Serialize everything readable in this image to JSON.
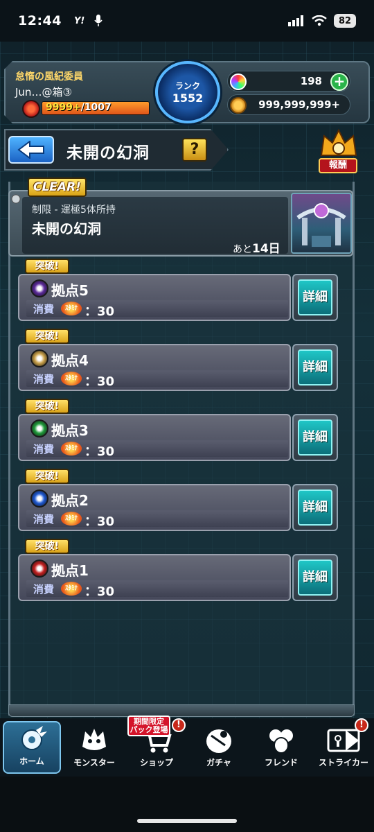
{
  "status_bar": {
    "time": "12:44",
    "carrier_logo": "Y!",
    "battery": "82"
  },
  "player": {
    "title": "怠惰の風紀委員",
    "name": "Jun…@箱③",
    "stamina_value": "9999+",
    "stamina_max": "/1007",
    "stamina_fill": 1.0,
    "rank_label": "ランク",
    "rank_value": "1552"
  },
  "currency": {
    "orbs": "198",
    "coins": "999,999,999+"
  },
  "quest_header": {
    "title": "未開の幻洞",
    "help_label": "?",
    "reward_label": "報酬"
  },
  "quest_card": {
    "clear_label": "CLEAR!",
    "restriction": "制限 - 運極5体所持",
    "name": "未開の幻洞",
    "remaining_prefix": "あと",
    "remaining_value": "14日"
  },
  "stages": [
    {
      "tag": "突破!",
      "name": "拠点5",
      "cost_label": "消費",
      "stamina_label": "ｽﾀﾐﾅ",
      "cost": "：30",
      "detail": "詳細",
      "element_color": "#5b2a9a"
    },
    {
      "tag": "突破!",
      "name": "拠点4",
      "cost_label": "消費",
      "stamina_label": "ｽﾀﾐﾅ",
      "cost": "：30",
      "detail": "詳細",
      "element_color": "#c9a04a"
    },
    {
      "tag": "突破!",
      "name": "拠点3",
      "cost_label": "消費",
      "stamina_label": "ｽﾀﾐﾅ",
      "cost": "：30",
      "detail": "詳細",
      "element_color": "#1f9a3a"
    },
    {
      "tag": "突破!",
      "name": "拠点2",
      "cost_label": "消費",
      "stamina_label": "ｽﾀﾐﾅ",
      "cost": "：30",
      "detail": "詳細",
      "element_color": "#1f5ad4"
    },
    {
      "tag": "突破!",
      "name": "拠点1",
      "cost_label": "消費",
      "stamina_label": "ｽﾀﾐﾅ",
      "cost": "：30",
      "detail": "詳細",
      "element_color": "#c42020"
    }
  ],
  "nav": {
    "home": "ホーム",
    "monster": "モンスター",
    "shop": "ショップ",
    "gacha": "ガチャ",
    "friend": "フレンド",
    "striker": "ストライカー",
    "limited_badge": "期間限定\nパック登場",
    "alert": "!"
  }
}
